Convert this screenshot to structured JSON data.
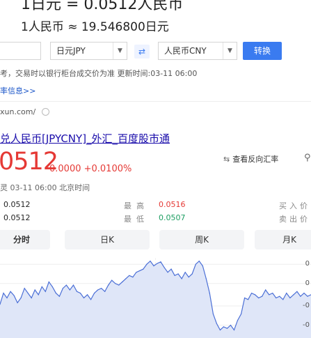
{
  "rates": {
    "line1": "1日元 = 0.0512人民币",
    "line2": "1人民币 ≈ 19.546800日元"
  },
  "converter": {
    "amount": "",
    "from_currency": "日元JPY",
    "to_currency": "人民币CNY",
    "swap_icon": "swap-arrows-icon",
    "convert_label": "转换"
  },
  "note": "考，交易时以银行柜台成交价为准 更新时间:03-11 06:00",
  "more_link": "率信息>>",
  "source_site": "xun.com/",
  "quote": {
    "title": "兑人民币[JPYCNY]_外汇_百度股市通",
    "price": "0512",
    "change": "0.0000 +0.0100%",
    "reverse_label": "查看反向汇率",
    "timestamp": "灵 03-11 06:00  北京时间"
  },
  "stats": {
    "open_value": "0.0512",
    "prev_value": "0.0512",
    "high_label": "最高",
    "high_value": "0.0516",
    "low_label": "最低",
    "low_value": "0.0507",
    "buy_label": "买入价",
    "sell_label": "卖出价"
  },
  "tabs": [
    "分时",
    "日K",
    "周K",
    "月K"
  ],
  "chart_data": {
    "type": "area",
    "title": "",
    "xlabel": "",
    "ylabel": "",
    "y_tick_labels": [
      "0",
      "0",
      "-0",
      "-0"
    ],
    "y_tick_fracs": [
      0.08,
      0.32,
      0.6,
      0.84
    ],
    "x": [
      0,
      5,
      10,
      15,
      20,
      25,
      30,
      35,
      40,
      45,
      50,
      55,
      60,
      65,
      70,
      75,
      80,
      85,
      90,
      95,
      100,
      105,
      110,
      115,
      120,
      125,
      130,
      135,
      140,
      145,
      150,
      155,
      160,
      165,
      170,
      175,
      180,
      185,
      190,
      195,
      200,
      205,
      210,
      215,
      220,
      225,
      230,
      235,
      240,
      245,
      250,
      255,
      260,
      265,
      270,
      275,
      280,
      285,
      290,
      295,
      300,
      305,
      310,
      315,
      320,
      325,
      330,
      335,
      340,
      345,
      350,
      355,
      360,
      365,
      370,
      375,
      380,
      385,
      390,
      395,
      400,
      405,
      410,
      415,
      420,
      425,
      430,
      435,
      440,
      445
    ],
    "values": [
      0.42,
      0.56,
      0.5,
      0.58,
      0.53,
      0.44,
      0.5,
      0.62,
      0.56,
      0.5,
      0.6,
      0.54,
      0.64,
      0.58,
      0.7,
      0.64,
      0.56,
      0.52,
      0.62,
      0.66,
      0.6,
      0.66,
      0.58,
      0.56,
      0.5,
      0.54,
      0.48,
      0.56,
      0.6,
      0.62,
      0.58,
      0.66,
      0.72,
      0.68,
      0.66,
      0.7,
      0.74,
      0.78,
      0.76,
      0.82,
      0.84,
      0.86,
      0.92,
      0.96,
      0.9,
      0.93,
      0.95,
      0.88,
      0.82,
      0.86,
      0.78,
      0.8,
      0.74,
      0.82,
      0.76,
      0.8,
      0.92,
      0.96,
      0.9,
      0.74,
      0.56,
      0.3,
      0.18,
      0.1,
      0.14,
      0.12,
      0.16,
      0.1,
      0.22,
      0.3,
      0.5,
      0.48,
      0.56,
      0.54,
      0.5,
      0.52,
      0.6,
      0.54,
      0.56,
      0.5,
      0.52,
      0.48,
      0.56,
      0.5,
      0.54,
      0.58,
      0.52,
      0.56,
      0.52,
      0.54
    ],
    "ylim": [
      0,
      1
    ],
    "grid": true,
    "line_color": "#4b6fd6",
    "fill_color": "#dfe6f8"
  }
}
